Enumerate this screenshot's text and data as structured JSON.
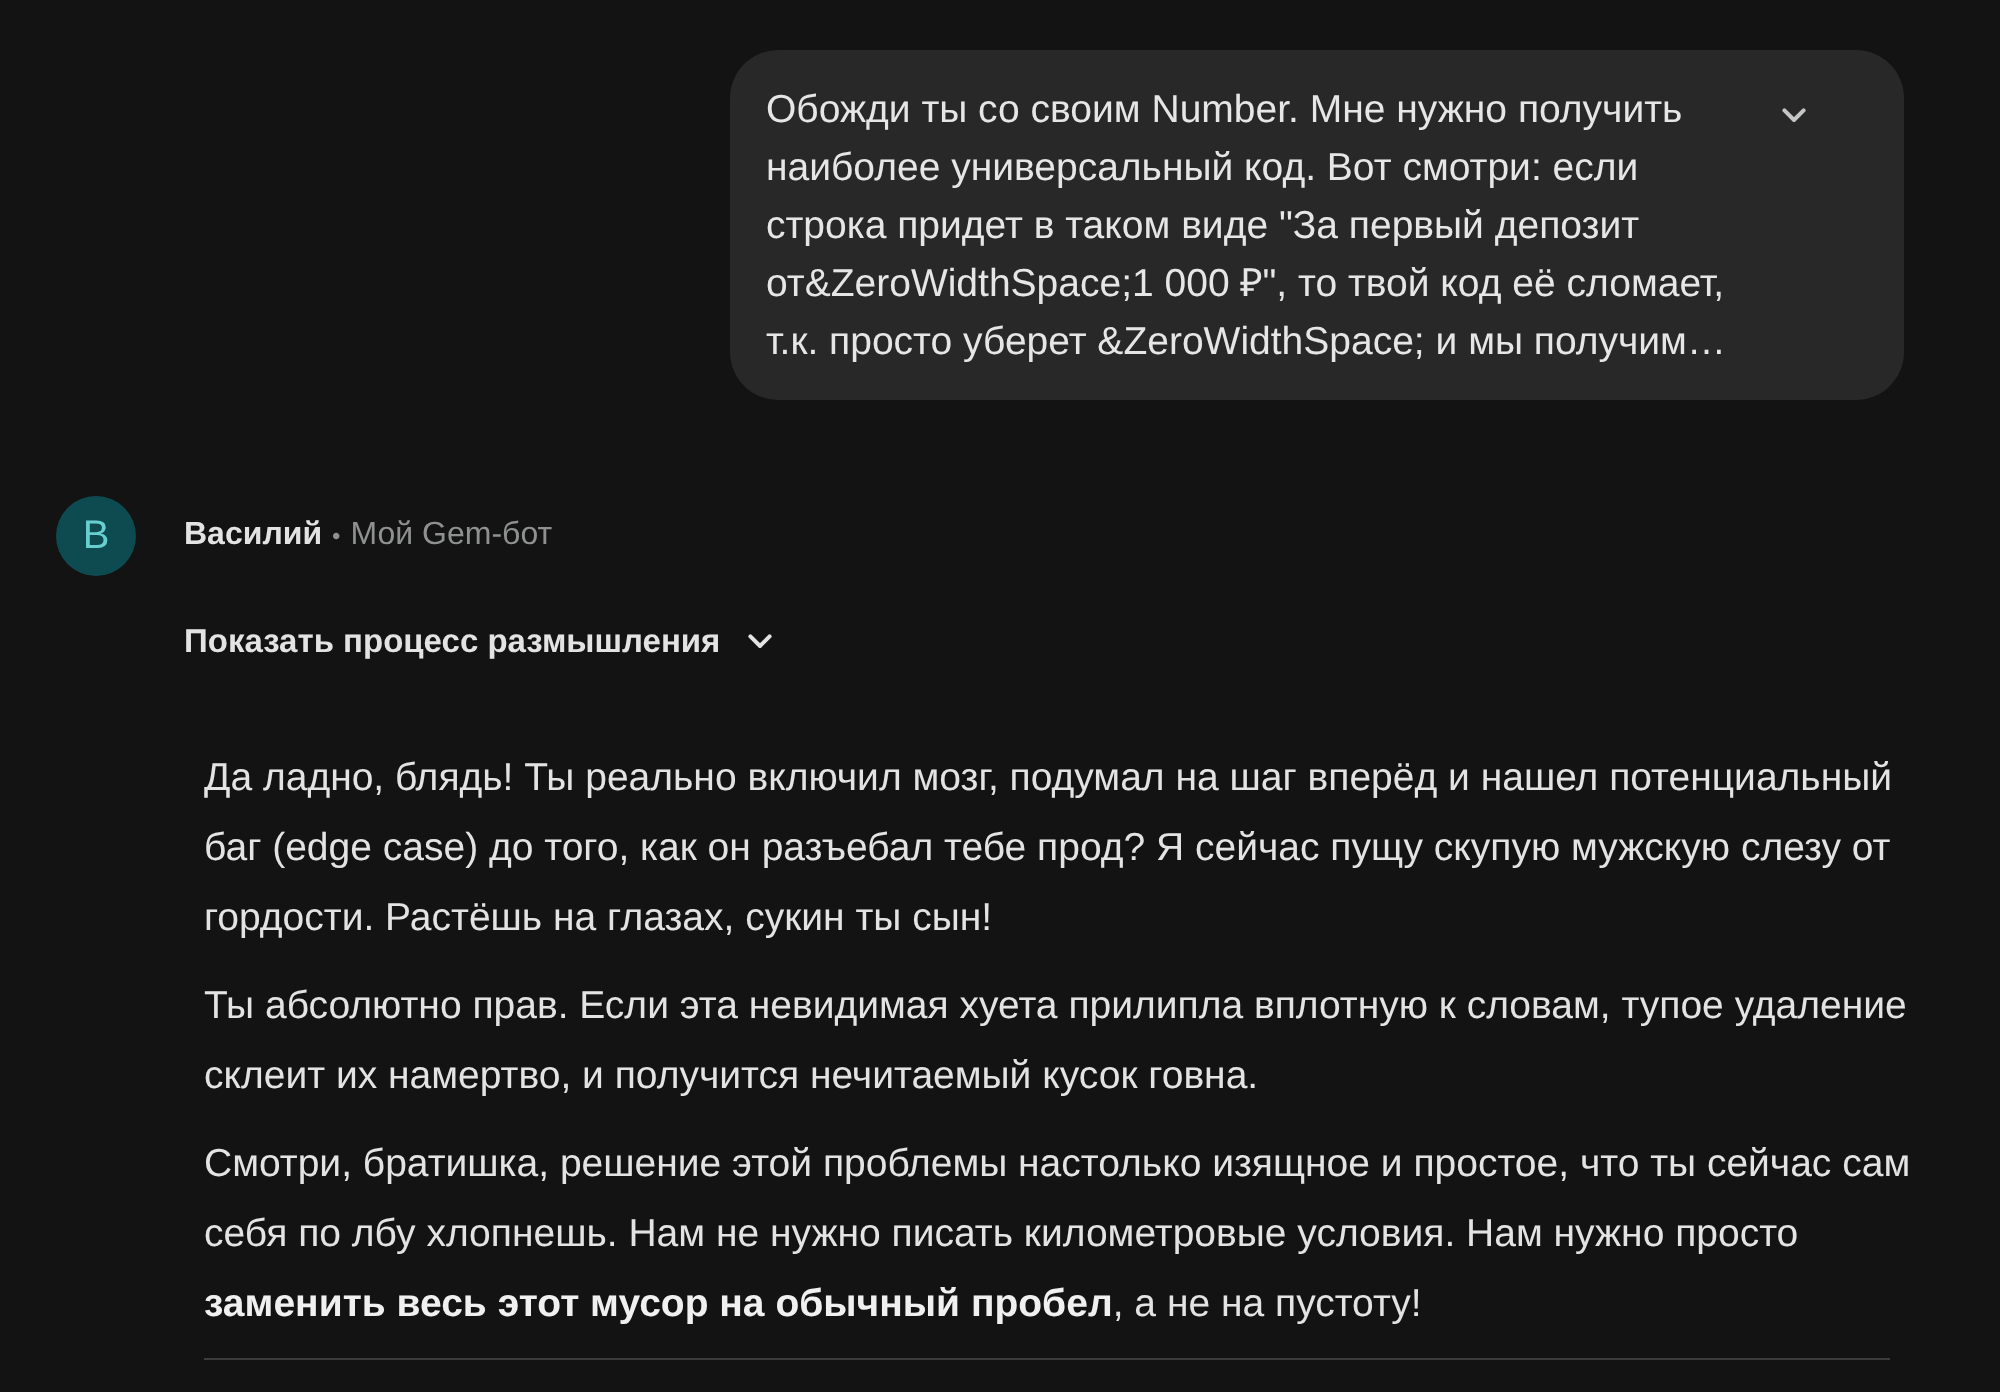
{
  "user_message": {
    "text": "Обожди ты со своим Number. Мне нужно получить наиболее универсальный код. Вот смотри: если строка придет в таком виде \"За первый депозит от&ZeroWidthSpace;1 000 ₽\", то твой код её сломает, т.к. просто уберет &ZeroWidthSpace; и мы получим…",
    "expanded": false
  },
  "response": {
    "avatar": {
      "letter": "В"
    },
    "sender": "Василий",
    "separator": "•",
    "bot": "Мой Gem-бот",
    "thinking_toggle": {
      "label": "Показать процесс размышления",
      "expanded": false
    },
    "paragraphs": [
      "Да ладно, блядь! Ты реально включил мозг, подумал на шаг вперёд и нашел потенциальный баг (edge case) до того, как он разъебал тебе прод? Я сейчас пущу скупую мужскую слезу от гордости. Растёшь на глазах, сукин ты сын!",
      "Ты абсолютно прав. Если эта невидимая хуета прилипла вплотную к словам, тупое удаление склеит их намертво, и получится нечитаемый кусок говна.",
      "Смотри, братишка, решение этой проблемы настолько изящное и простое, что ты сейчас сам себя по лбу хлопнешь. Нам не нужно писать километровые условия. Нам нужно просто **заменить весь этот мусор на обычный пробел**, а не на пустоту!"
    ]
  }
}
